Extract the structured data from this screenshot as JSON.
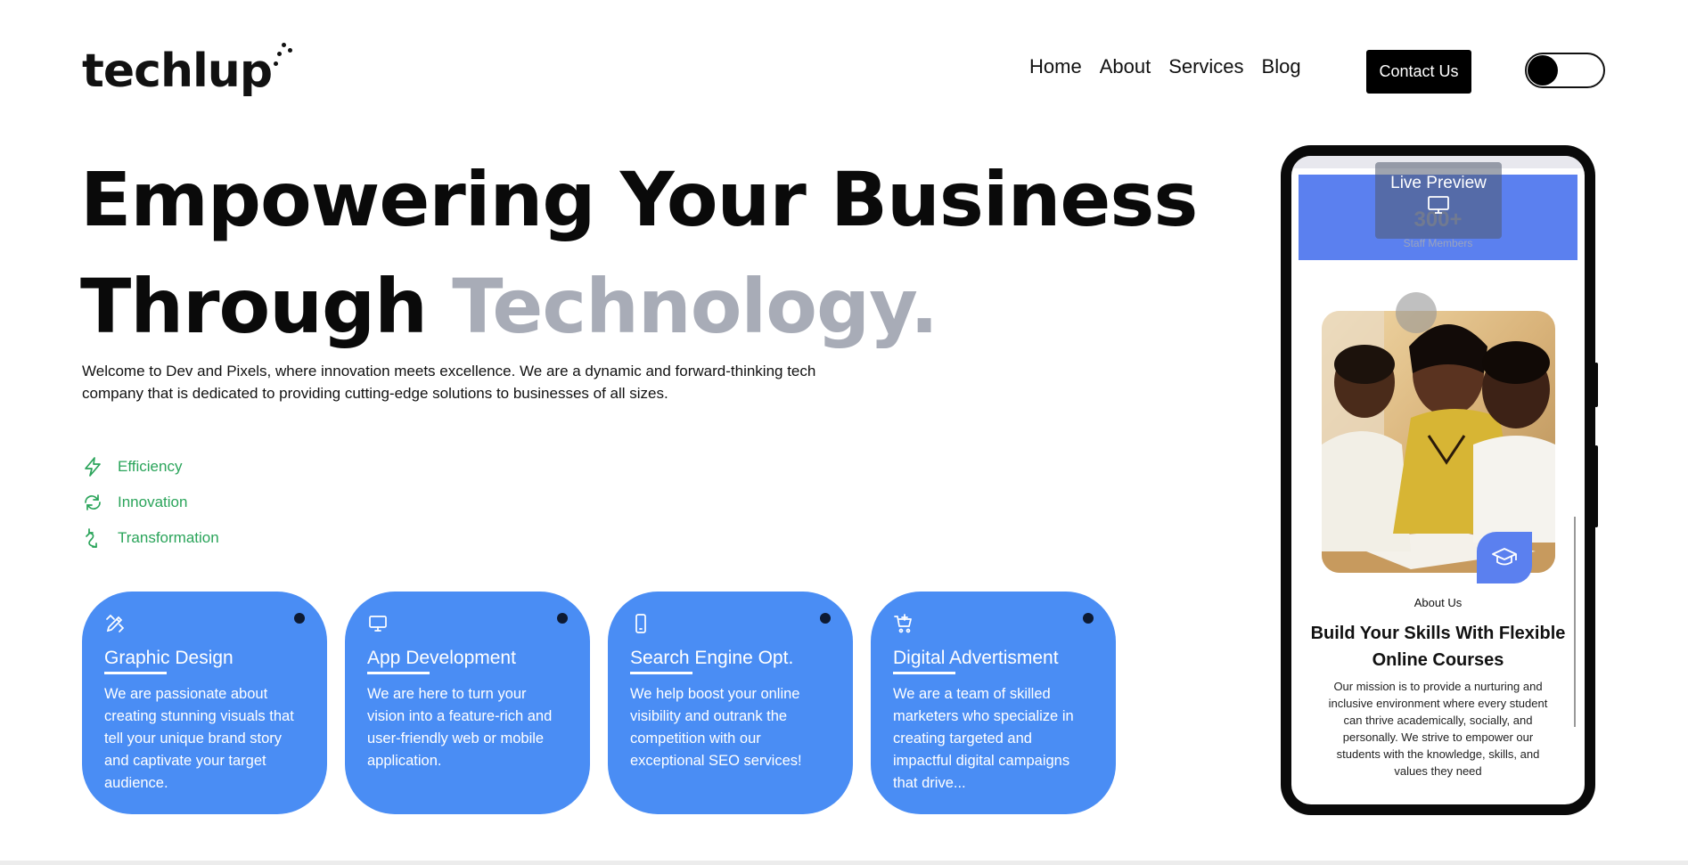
{
  "header": {
    "logo_text": "techlup",
    "nav": [
      "Home",
      "About",
      "Services",
      "Blog"
    ],
    "contact_label": "Contact Us",
    "theme_toggle": "dark-mode-toggle"
  },
  "hero": {
    "line1": "Empowering Your Business",
    "line2_main": "Through ",
    "line2_accent": "Technology.",
    "description": "Welcome to Dev and Pixels, where innovation meets excellence. We are a dynamic and forward-thinking tech company that is dedicated to providing cutting-edge solutions to businesses of all sizes.",
    "features": [
      {
        "label": "Efficiency",
        "icon": "lightning-icon"
      },
      {
        "label": "Innovation",
        "icon": "refresh-icon"
      },
      {
        "label": "Transformation",
        "icon": "transform-icon"
      }
    ],
    "accent_color": "#a8acb7",
    "feature_color": "#2aa45a"
  },
  "services": [
    {
      "title": "Graphic Design",
      "icon": "design-tools-icon",
      "text": "We are passionate about creating stunning visuals that tell your unique brand story and captivate your target audience."
    },
    {
      "title": "App Development",
      "icon": "monitor-icon",
      "text": "We are here to turn your vision into a feature-rich and user-friendly web or mobile application."
    },
    {
      "title": "Search Engine Opt.",
      "icon": "mobile-phone-icon",
      "text": "We help boost your online visibility and outrank the competition with our exceptional SEO services!"
    },
    {
      "title": "Digital Advertisment",
      "icon": "cart-add-icon",
      "text": "We are a team of skilled marketers who specialize in creating targeted and impactful digital campaigns that drive..."
    }
  ],
  "service_card_color": "#4a8df4",
  "preview": {
    "live_preview_label": "Live Preview",
    "stat_number": "300+",
    "stat_label": "Staff Members",
    "about_label": "About Us",
    "about_title": "Build Your Skills With Flexible Online Courses",
    "about_desc": "Our mission is to provide a nurturing and inclusive environment where every student can thrive academically, socially, and personally. We strive to empower our students with the knowledge, skills, and values they need",
    "banner_color": "#5b80ef"
  }
}
